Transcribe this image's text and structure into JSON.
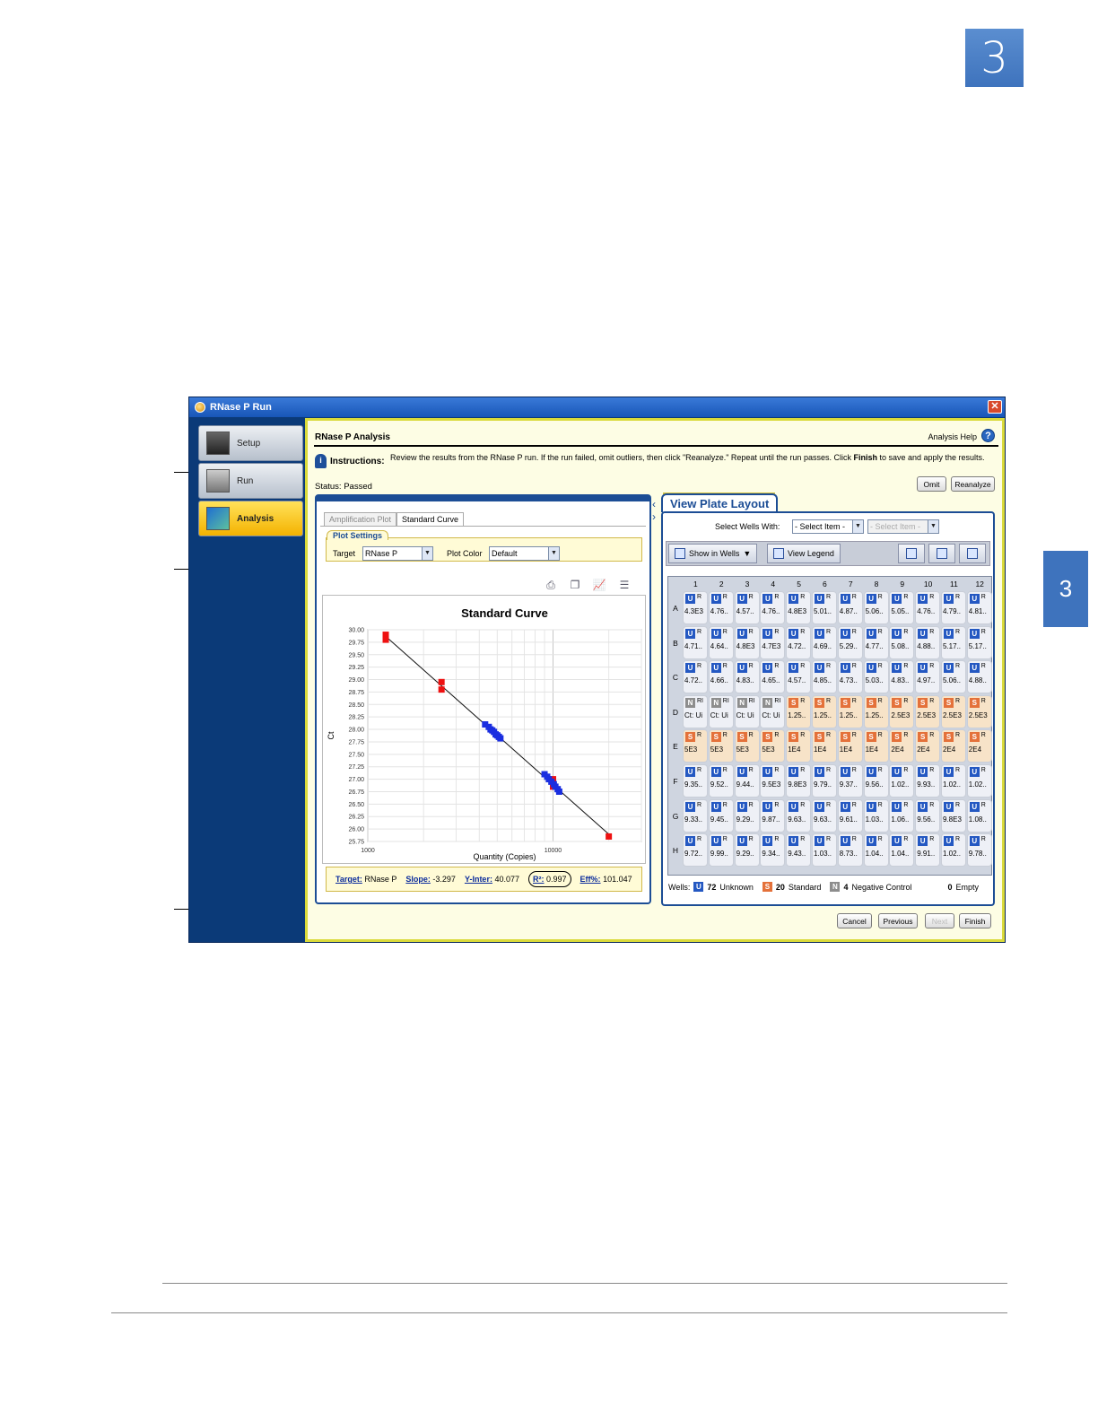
{
  "doc": {
    "chapter_number": "3",
    "side_tab_number": "3"
  },
  "window": {
    "title": "RNase P Run",
    "close_glyph": "✕",
    "nav": [
      {
        "label": "Setup",
        "icon": "instrument-icon"
      },
      {
        "label": "Run",
        "icon": "run-icon"
      },
      {
        "label": "Analysis",
        "icon": "analysis-icon",
        "active": true
      }
    ]
  },
  "analysis": {
    "title": "RNase P Analysis",
    "help_label": "Analysis Help",
    "help_glyph": "?",
    "instructions_label": "Instructions:",
    "instructions_pre": "Review the results from the RNase P run. If the run failed, omit outliers, then click \"Reanalyze.\" Repeat until the run passes. Click ",
    "instructions_bold": "Finish",
    "instructions_post": " to save and apply the results.",
    "status": "Status: Passed",
    "omit_label": "Omit",
    "reanalyze_label": "Reanalyze"
  },
  "left_panel": {
    "tabs": [
      "Amplification Plot",
      "Standard Curve"
    ],
    "plot_settings_label": "Plot Settings",
    "target_label": "Target",
    "target_value": "RNase P",
    "plot_color_label": "Plot Color",
    "plot_color_value": "Default",
    "tools": [
      "print-icon",
      "copy-icon",
      "chart-icon",
      "list-icon"
    ],
    "results": {
      "target_label": "Target:",
      "target_value": "RNase P",
      "slope_label": "Slope:",
      "slope_value": "-3.297",
      "yinter_label": "Y-Inter:",
      "yinter_value": "40.077",
      "r2_label": "R²:",
      "r2_value": "0.997",
      "eff_label": "Eff%:",
      "eff_value": "101.047"
    }
  },
  "chart_data": {
    "type": "scatter",
    "title": "Standard Curve",
    "xlabel": "Quantity (Copies)",
    "ylabel": "Ct",
    "x_scale": "log",
    "xlim": [
      1000,
      30000
    ],
    "x_ticks": [
      1000,
      10000
    ],
    "ylim": [
      25.75,
      30.0
    ],
    "y_ticks": [
      "30.00",
      "29.75",
      "29.50",
      "29.25",
      "29.00",
      "28.75",
      "28.50",
      "28.25",
      "28.00",
      "27.75",
      "27.50",
      "27.25",
      "27.00",
      "26.75",
      "26.50",
      "26.25",
      "26.00",
      "25.75"
    ],
    "grid": true,
    "series": [
      {
        "name": "Standard",
        "color": "#ee1111",
        "points": [
          [
            1250,
            29.9
          ],
          [
            1250,
            29.8
          ],
          [
            2500,
            28.95
          ],
          [
            2500,
            28.8
          ],
          [
            10000,
            26.95
          ],
          [
            10000,
            26.85
          ],
          [
            10000,
            27.0
          ],
          [
            20000,
            25.85
          ]
        ]
      },
      {
        "name": "Unknown",
        "color": "#1a2ee0",
        "points": [
          [
            4300,
            28.1
          ],
          [
            4500,
            28.05
          ],
          [
            4600,
            28.0
          ],
          [
            4700,
            27.98
          ],
          [
            4800,
            27.95
          ],
          [
            4900,
            27.9
          ],
          [
            5000,
            27.88
          ],
          [
            5100,
            27.85
          ],
          [
            5200,
            27.82
          ],
          [
            9000,
            27.1
          ],
          [
            9300,
            27.05
          ],
          [
            9500,
            27.0
          ],
          [
            9800,
            26.95
          ],
          [
            10100,
            26.9
          ],
          [
            10300,
            26.85
          ],
          [
            10600,
            26.8
          ],
          [
            10800,
            26.75
          ]
        ]
      }
    ],
    "fit_line": {
      "slope": -3.297,
      "intercept": 40.077
    }
  },
  "right_panel": {
    "tab_label": "View Plate Layout",
    "select_label": "Select Wells With:",
    "select1": "- Select Item -",
    "select2": "- Select Item -",
    "show_in_wells": "Show in Wells",
    "view_legend": "View Legend",
    "columns": [
      "1",
      "2",
      "3",
      "4",
      "5",
      "6",
      "7",
      "8",
      "9",
      "10",
      "11",
      "12"
    ],
    "rows": [
      "A",
      "B",
      "C",
      "D",
      "E",
      "F",
      "G",
      "H"
    ],
    "plate": [
      [
        [
          "U",
          "4.3E3"
        ],
        [
          "U",
          "4.76.."
        ],
        [
          "U",
          "4.57.."
        ],
        [
          "U",
          "4.76.."
        ],
        [
          "U",
          "4.8E3"
        ],
        [
          "U",
          "5.01.."
        ],
        [
          "U",
          "4.87.."
        ],
        [
          "U",
          "5.06.."
        ],
        [
          "U",
          "5.05.."
        ],
        [
          "U",
          "4.76.."
        ],
        [
          "U",
          "4.79.."
        ],
        [
          "U",
          "4.81.."
        ]
      ],
      [
        [
          "U",
          "4.71.."
        ],
        [
          "U",
          "4.64.."
        ],
        [
          "U",
          "4.8E3"
        ],
        [
          "U",
          "4.7E3"
        ],
        [
          "U",
          "4.72.."
        ],
        [
          "U",
          "4.69.."
        ],
        [
          "U",
          "5.29.."
        ],
        [
          "U",
          "4.77.."
        ],
        [
          "U",
          "5.08.."
        ],
        [
          "U",
          "4.88.."
        ],
        [
          "U",
          "5.17.."
        ],
        [
          "U",
          "5.17.."
        ]
      ],
      [
        [
          "U",
          "4.72.."
        ],
        [
          "U",
          "4.66.."
        ],
        [
          "U",
          "4.83.."
        ],
        [
          "U",
          "4.65.."
        ],
        [
          "U",
          "4.57.."
        ],
        [
          "U",
          "4.85.."
        ],
        [
          "U",
          "4.73.."
        ],
        [
          "U",
          "5.03.."
        ],
        [
          "U",
          "4.83.."
        ],
        [
          "U",
          "4.97.."
        ],
        [
          "U",
          "5.06.."
        ],
        [
          "U",
          "4.88.."
        ]
      ],
      [
        [
          "N",
          "Ct: Ui"
        ],
        [
          "N",
          "Ct: Ui"
        ],
        [
          "N",
          "Ct: Ui"
        ],
        [
          "N",
          "Ct: Ui"
        ],
        [
          "S",
          "1.25.."
        ],
        [
          "S",
          "1.25.."
        ],
        [
          "S",
          "1.25.."
        ],
        [
          "S",
          "1.25.."
        ],
        [
          "S",
          "2.5E3"
        ],
        [
          "S",
          "2.5E3"
        ],
        [
          "S",
          "2.5E3"
        ],
        [
          "S",
          "2.5E3"
        ]
      ],
      [
        [
          "S",
          "5E3"
        ],
        [
          "S",
          "5E3"
        ],
        [
          "S",
          "5E3"
        ],
        [
          "S",
          "5E3"
        ],
        [
          "S",
          "1E4"
        ],
        [
          "S",
          "1E4"
        ],
        [
          "S",
          "1E4"
        ],
        [
          "S",
          "1E4"
        ],
        [
          "S",
          "2E4"
        ],
        [
          "S",
          "2E4"
        ],
        [
          "S",
          "2E4"
        ],
        [
          "S",
          "2E4"
        ]
      ],
      [
        [
          "U",
          "9.35.."
        ],
        [
          "U",
          "9.52.."
        ],
        [
          "U",
          "9.44.."
        ],
        [
          "U",
          "9.5E3"
        ],
        [
          "U",
          "9.8E3"
        ],
        [
          "U",
          "9.79.."
        ],
        [
          "U",
          "9.37.."
        ],
        [
          "U",
          "9.56.."
        ],
        [
          "U",
          "1.02.."
        ],
        [
          "U",
          "9.93.."
        ],
        [
          "U",
          "1.02.."
        ],
        [
          "U",
          "1.02.."
        ]
      ],
      [
        [
          "U",
          "9.33.."
        ],
        [
          "U",
          "9.45.."
        ],
        [
          "U",
          "9.29.."
        ],
        [
          "U",
          "9.87.."
        ],
        [
          "U",
          "9.63.."
        ],
        [
          "U",
          "9.63.."
        ],
        [
          "U",
          "9.61.."
        ],
        [
          "U",
          "1.03.."
        ],
        [
          "U",
          "1.06.."
        ],
        [
          "U",
          "9.56.."
        ],
        [
          "U",
          "9.8E3"
        ],
        [
          "U",
          "1.08.."
        ]
      ],
      [
        [
          "U",
          "9.72.."
        ],
        [
          "U",
          "9.99.."
        ],
        [
          "U",
          "9.29.."
        ],
        [
          "U",
          "9.34.."
        ],
        [
          "U",
          "9.43.."
        ],
        [
          "U",
          "1.03.."
        ],
        [
          "U",
          "8.73.."
        ],
        [
          "U",
          "1.04.."
        ],
        [
          "U",
          "1.04.."
        ],
        [
          "U",
          "9.91.."
        ],
        [
          "U",
          "1.02.."
        ],
        [
          "U",
          "9.78.."
        ]
      ]
    ],
    "legend": {
      "wells_label": "Wells:",
      "unknown_count": "72",
      "unknown_label": "Unknown",
      "standard_count": "20",
      "standard_label": "Standard",
      "ntc_count": "4",
      "ntc_label": "Negative Control",
      "empty_count": "0",
      "empty_label": "Empty"
    }
  },
  "footer_buttons": {
    "cancel": "Cancel",
    "previous": "Previous",
    "next": "Next",
    "finish": "Finish"
  }
}
